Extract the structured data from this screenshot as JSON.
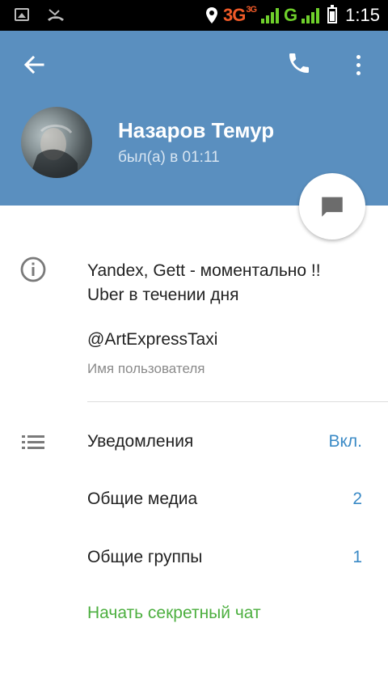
{
  "status_bar": {
    "network_1": "3G",
    "network_1_sup": "3G",
    "network_2": "G",
    "time": "1:15"
  },
  "header": {
    "name": "Назаров Темур",
    "last_seen": "был(а) в 01:11",
    "background_color": "#5a8fbf"
  },
  "info": {
    "bio_line_1": "Yandex, Gett - моментально !!",
    "bio_line_2": "Uber в течении дня",
    "username": "@ArtExpressTaxi",
    "username_caption": "Имя пользователя"
  },
  "settings": {
    "notifications_label": "Уведомления",
    "notifications_value": "Вкл.",
    "shared_media_label": "Общие медиа",
    "shared_media_value": "2",
    "common_groups_label": "Общие группы",
    "common_groups_value": "1",
    "secret_chat_label": "Начать секретный чат"
  },
  "colors": {
    "accent_blue": "#3a8ac6",
    "secret_green": "#4caf3f"
  },
  "icons": [
    "back-arrow-icon",
    "phone-icon",
    "more-vert-icon",
    "message-icon",
    "info-icon",
    "list-icon"
  ]
}
